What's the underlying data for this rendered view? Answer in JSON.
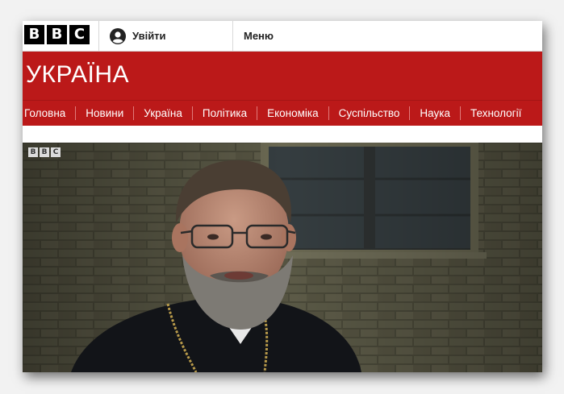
{
  "header": {
    "logo_letters": [
      "B",
      "B",
      "C"
    ],
    "signin_label": "Увійти",
    "menu_label": "Меню"
  },
  "section": {
    "title": "УКРАЇНА",
    "accent_color": "#bb1919"
  },
  "nav": {
    "items": [
      {
        "label": "Головна"
      },
      {
        "label": "Новини"
      },
      {
        "label": "Україна"
      },
      {
        "label": "Політика"
      },
      {
        "label": "Економіка"
      },
      {
        "label": "Суспільство"
      },
      {
        "label": "Наука"
      },
      {
        "label": "Технології"
      }
    ]
  },
  "video": {
    "badge_letters": [
      "B",
      "B",
      "C"
    ]
  }
}
